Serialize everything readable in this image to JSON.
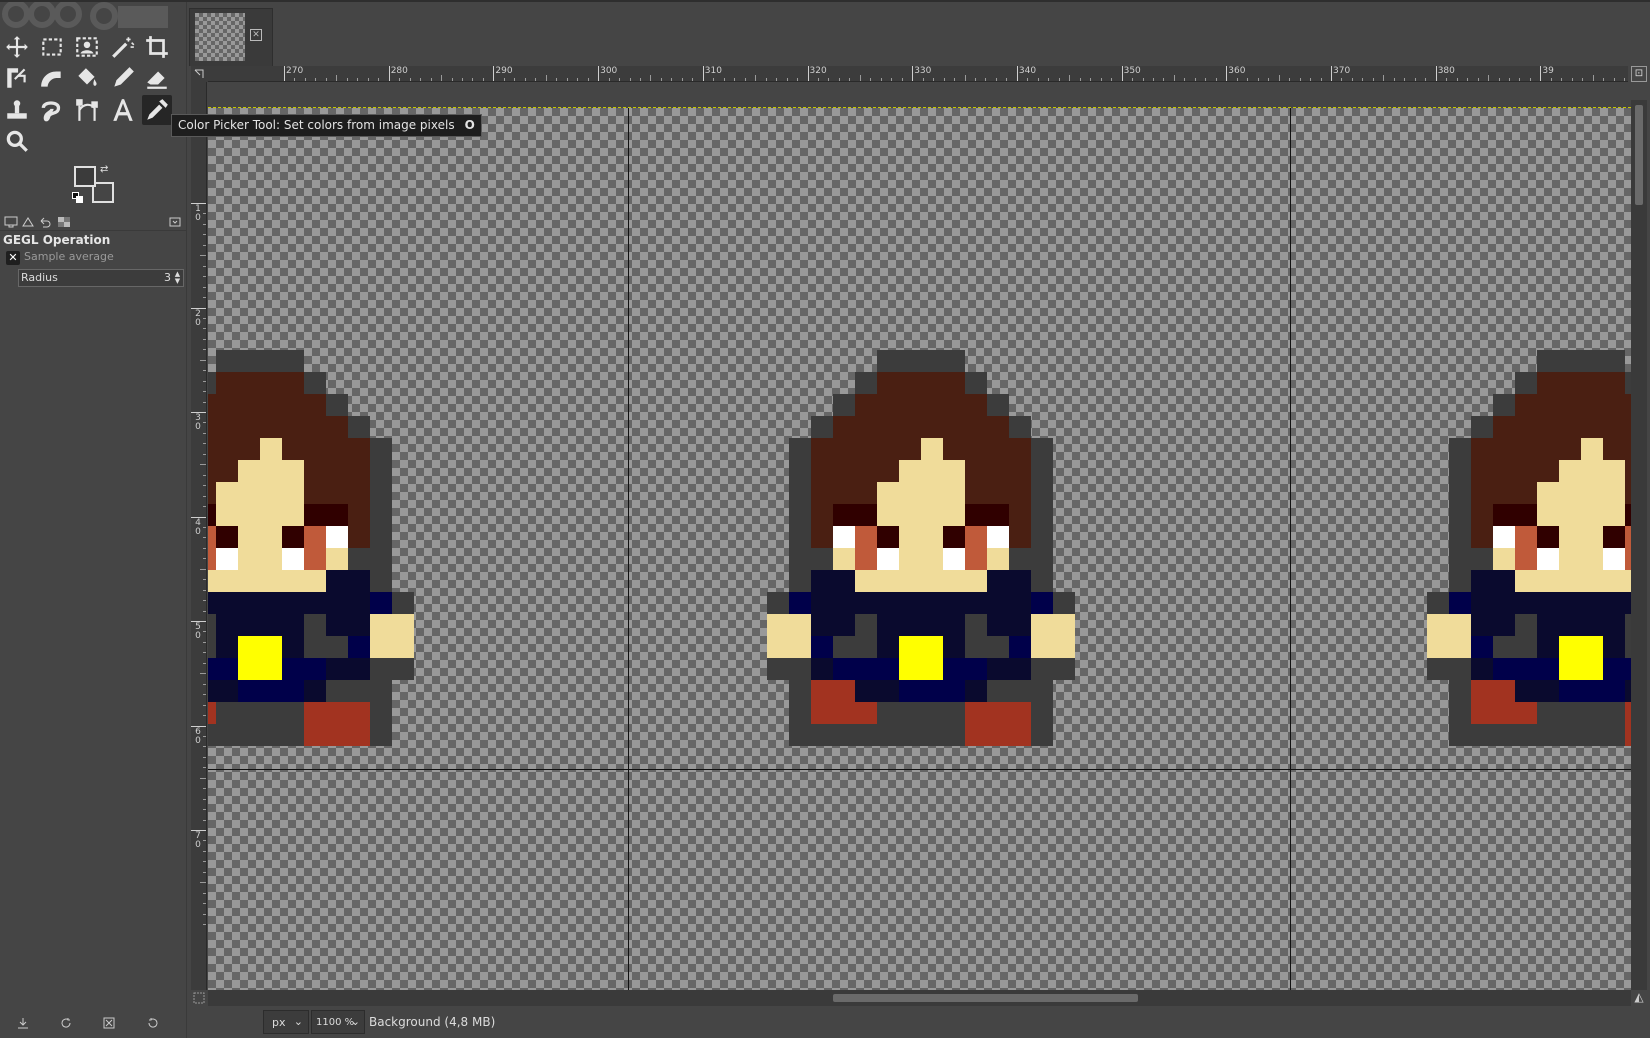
{
  "toolbox": {
    "tools": [
      {
        "name": "move-tool-icon"
      },
      {
        "name": "rect-select-icon"
      },
      {
        "name": "foreground-select-icon"
      },
      {
        "name": "fuzzy-select-icon"
      },
      {
        "name": "crop-icon"
      },
      {
        "name": "unified-transform-icon"
      },
      {
        "name": "warp-transform-icon"
      },
      {
        "name": "bucket-fill-icon"
      },
      {
        "name": "pencil-icon"
      },
      {
        "name": "eraser-icon"
      },
      {
        "name": "clone-icon"
      },
      {
        "name": "smudge-icon"
      },
      {
        "name": "paths-icon"
      },
      {
        "name": "text-tool-icon"
      },
      {
        "name": "color-picker-icon"
      },
      {
        "name": "zoom-icon"
      }
    ],
    "active_tool": "color-picker-icon"
  },
  "colors": {
    "foreground": "#3b3b3b",
    "background": "#454545",
    "accent_selection": "#c8c800"
  },
  "tool_options": {
    "title": "GEGL Operation",
    "sample_average_label": "Sample average",
    "radius_label": "Radius",
    "radius_value": "3"
  },
  "tooltip": {
    "text": "Color Picker Tool: Set colors from image pixels",
    "shortcut": "O"
  },
  "ruler": {
    "top_labels": [
      "270",
      "280",
      "290",
      "300",
      "310",
      "320",
      "330",
      "340",
      "350",
      "360",
      "370",
      "380",
      "39"
    ],
    "left_labels": [
      [
        "1",
        "0"
      ],
      [
        "2",
        "0"
      ],
      [
        "3",
        "0"
      ],
      [
        "4",
        "0"
      ],
      [
        "5",
        "0"
      ],
      [
        "6",
        "0"
      ],
      [
        "7",
        "0"
      ]
    ]
  },
  "status": {
    "unit": "px",
    "zoom": "1100 %",
    "layer_info": "Background (4,8 MB)"
  }
}
